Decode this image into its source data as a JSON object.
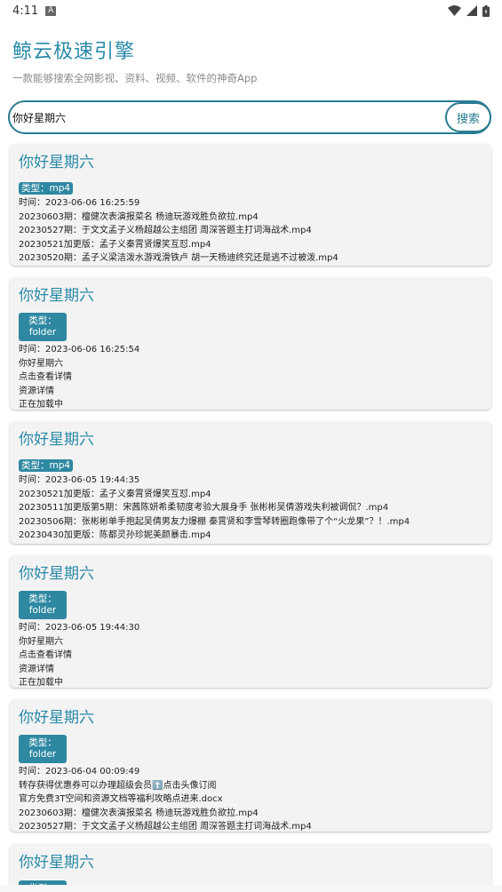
{
  "status": {
    "time": "4:11",
    "notif_icon": "a-box-icon"
  },
  "header": {
    "title": "鲸云极速引擎",
    "subtitle": "一款能够搜索全网影视、资料、视频、软件的神奇App"
  },
  "search": {
    "value": "你好星期六",
    "button": "搜索"
  },
  "colors": {
    "accent": "#2a8aa8",
    "badge": "#2f88a2",
    "card": "#f3f3f3"
  },
  "results": [
    {
      "title": "你好星期六",
      "type": "类型：mp4",
      "time": "时间：2023-06-06 16:25:59",
      "lines": [
        "20230603期：檀健次表演报菜名 杨迪玩游戏胜负欲拉.mp4",
        "20230527期：于文文孟子义杨超越公主组团 周深答题主打词海战术.mp4",
        "20230521加更版：孟子义秦霄贤爆笑互怼.mp4",
        "20230520期：孟子义梁洁泼水游戏滑铁卢 胡一天杨迪终究还是逃不过被泼.mp4"
      ]
    },
    {
      "title": "你好星期六",
      "type": "类型：folder",
      "time": "时间：2023-06-06 16:25:54",
      "lines": [
        "你好星期六",
        "点击查看详情",
        "资源详情",
        "正在加载中"
      ]
    },
    {
      "title": "你好星期六",
      "type": "类型：mp4",
      "time": "时间：2023-06-05 19:44:35",
      "lines": [
        "20230521加更版：孟子义秦霄贤爆笑互怼.mp4",
        "20230511加更版第5期：宋茜陈妍希柔韧度考验大展身手 张彬彬吴倩游戏失利被调侃？.mp4",
        "20230506期：张彬彬单手抱起吴倩男友力爆棚 秦霄贤和李雪琴转圈跑像带了个“火龙果”？！.mp4",
        "20230430加更版：陈都灵孙珍妮美颜暴击.mp4"
      ]
    },
    {
      "title": "你好星期六",
      "type": "类型：folder",
      "time": "时间：2023-06-05 19:44:30",
      "lines": [
        "你好星期六",
        "点击查看详情",
        "资源详情",
        "正在加载中"
      ]
    },
    {
      "title": "你好星期六",
      "type": "类型：folder",
      "time": "时间：2023-06-04 00:09:49",
      "lines": [
        "转存获得优惠券可以办理超级会员⬆️点击头像订阅",
        "官方免费3T空间和资源文档等福利攻略点进来.docx",
        "20230603期：檀健次表演报菜名 杨迪玩游戏胜负欲拉.mp4",
        "20230527期：于文文孟子义杨超越公主组团 周深答题主打词海战术.mp4"
      ]
    },
    {
      "title": "你好星期六",
      "type": "类型：",
      "time": "",
      "lines": []
    }
  ]
}
